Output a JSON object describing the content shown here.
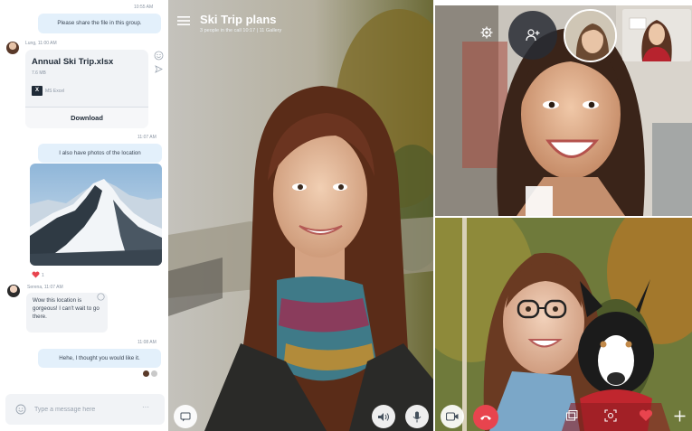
{
  "chat": {
    "messages": [
      {
        "time": "10:55 AM",
        "text": "Please share the file in this group."
      },
      {
        "sender": "Lung, 11:00 AM"
      },
      {
        "time": "11:07 AM",
        "text": "I also have photos of the location"
      },
      {
        "reaction_count": "1",
        "sender": "Serena, 11:07 AM",
        "text": "Wow this location is gorgeous! I can't wait to go there."
      },
      {
        "time": "11:08 AM",
        "text": "Hehe, I thought you would like it."
      }
    ],
    "file": {
      "name": "Annual Ski Trip.xlsx",
      "size": "7.6 MB",
      "app": "MS Excel",
      "download_label": "Download"
    },
    "composer": {
      "placeholder": "Type a message here",
      "more": "···"
    }
  },
  "call": {
    "title": "Ski Trip plans",
    "subtitle": "3 people in the call 10:17 | 11 Gallery"
  },
  "colors": {
    "hangup": "#e8444e",
    "heart": "#e8444e",
    "bubble_out": "#e3f0fb",
    "bubble_in": "#f1f3f6"
  },
  "icons": [
    "smiley-icon",
    "send-icon",
    "excel-icon",
    "heart-icon",
    "chat-icon",
    "speaker-icon",
    "microphone-icon",
    "video-icon",
    "hangup-icon",
    "screen-share-icon",
    "snapshot-icon",
    "add-icon",
    "settings-icon",
    "add-person-icon",
    "hamburger-icon"
  ]
}
